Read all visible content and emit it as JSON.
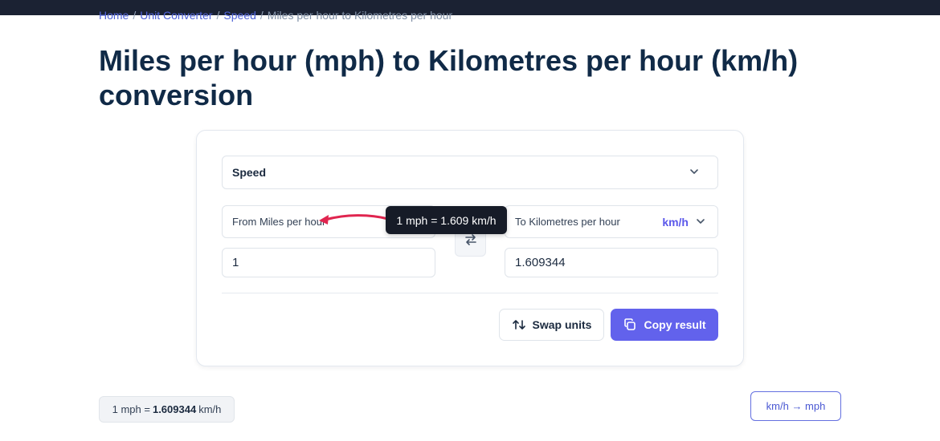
{
  "breadcrumb": {
    "home": "Home",
    "unit_converter": "Unit Converter",
    "speed": "Speed",
    "current": "Miles per hour to Kilometres per hour",
    "separator": "/"
  },
  "page_title": "Miles per hour (mph) to Kilometres per hour (km/h) conversion",
  "converter": {
    "category": "Speed",
    "from_label": "From Miles per hour",
    "to_label": "To Kilometres per hour",
    "to_abbr": "km/h",
    "from_value": "1",
    "to_value": "1.609344",
    "swap_units_label": "Swap units",
    "copy_result_label": "Copy result"
  },
  "tooltip": "1 mph = 1.609 km/h",
  "summary": {
    "prefix": "1 mph =",
    "value": "1.609344",
    "suffix": "km/h"
  },
  "reverse_link": "km/h → mph",
  "colors": {
    "accent": "#6262ec",
    "annotation_arrow": "#e0254f",
    "topbar": "#1b2233"
  }
}
